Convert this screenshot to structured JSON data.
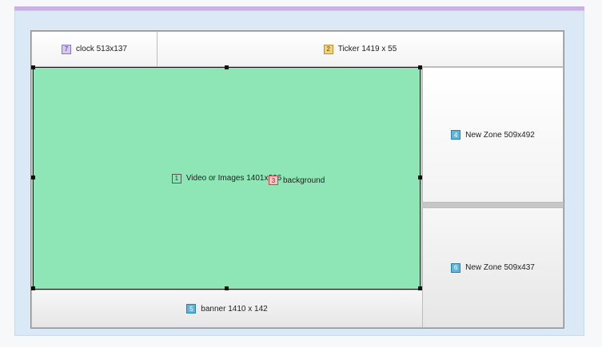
{
  "zones": {
    "clock": {
      "number": "7",
      "label": "clock 513x137"
    },
    "ticker": {
      "number": "2",
      "label": "Ticker 1419 x 55"
    },
    "video": {
      "number": "1",
      "label": "Video or Images 1401x806"
    },
    "background": {
      "number": "3",
      "label": "background"
    },
    "zone4": {
      "number": "4",
      "label": "New Zone 509x492"
    },
    "zone6": {
      "number": "6",
      "label": "New Zone 509x437"
    },
    "banner": {
      "number": "5",
      "label": "banner 1410 x 142"
    }
  },
  "colors": {
    "selected_zone": "#8ee5b5",
    "accent_bar": "#c9b2e3",
    "badge_purple": "#d5c8f0",
    "badge_yellow": "#f3d27a",
    "badge_blue": "#5fb6da"
  }
}
